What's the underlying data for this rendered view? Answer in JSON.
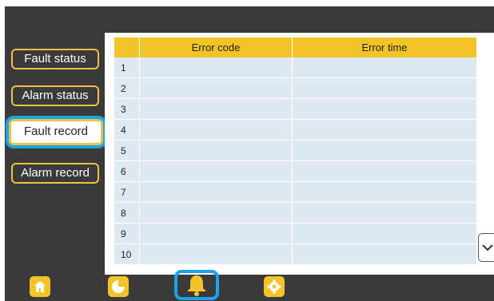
{
  "sidebar": {
    "items": [
      {
        "label": "Fault status",
        "active": false
      },
      {
        "label": "Alarm status",
        "active": false
      },
      {
        "label": "Fault record",
        "active": true
      },
      {
        "label": "Alarm record",
        "active": false
      }
    ]
  },
  "table": {
    "headers": [
      "",
      "Error code",
      "Error time"
    ],
    "rows": [
      {
        "num": "1",
        "code": "",
        "time": ""
      },
      {
        "num": "2",
        "code": "",
        "time": ""
      },
      {
        "num": "3",
        "code": "",
        "time": ""
      },
      {
        "num": "4",
        "code": "",
        "time": ""
      },
      {
        "num": "5",
        "code": "",
        "time": ""
      },
      {
        "num": "6",
        "code": "",
        "time": ""
      },
      {
        "num": "7",
        "code": "",
        "time": ""
      },
      {
        "num": "8",
        "code": "",
        "time": ""
      },
      {
        "num": "9",
        "code": "",
        "time": ""
      },
      {
        "num": "10",
        "code": "",
        "time": ""
      }
    ]
  },
  "nav": {
    "items": [
      {
        "icon": "home-icon",
        "active": false
      },
      {
        "icon": "pie-chart-icon",
        "active": false
      },
      {
        "icon": "bell-icon",
        "active": true
      },
      {
        "icon": "gear-icon",
        "active": false
      }
    ]
  },
  "colors": {
    "accent": "#f2c428",
    "highlight": "#1aa3e8",
    "background": "#3a3a3a",
    "row": "#dfe9f2"
  }
}
